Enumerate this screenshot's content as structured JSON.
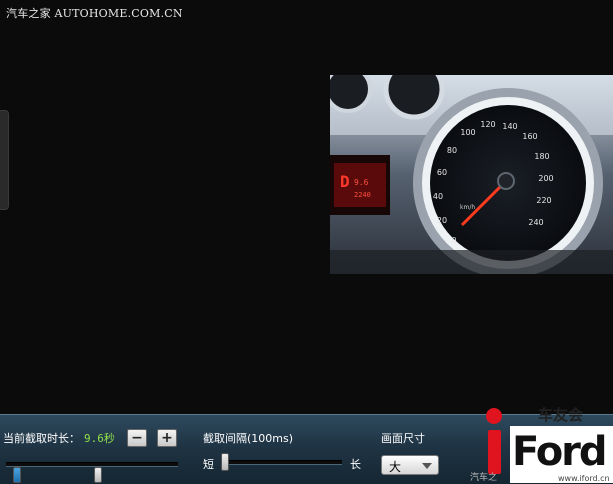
{
  "watermark": "汽车之家 AUTOHOME.COM.CN",
  "preview": {
    "speedo_ticks": [
      "0",
      "20",
      "40",
      "60",
      "80",
      "100",
      "120",
      "140",
      "160",
      "180",
      "200",
      "220",
      "240"
    ],
    "unit": "km/h"
  },
  "controls": {
    "duration_label": "当前截取时长：",
    "duration_value": "9.6秒",
    "minus_label": "−",
    "plus_label": "+",
    "interval_label": "截取间隔(100ms)",
    "interval_short": "短",
    "interval_long": "长",
    "size_label": "画面尺寸",
    "size_value": "大"
  },
  "logo": {
    "top_text": "车友会",
    "brand_text": "Ford",
    "url_text": "www.iford.cn",
    "autohome_text": "汽车之"
  },
  "colors": {
    "toolbar": "#1f3444",
    "accent_value": "#8ee04a",
    "logo_red": "#e0141e"
  }
}
